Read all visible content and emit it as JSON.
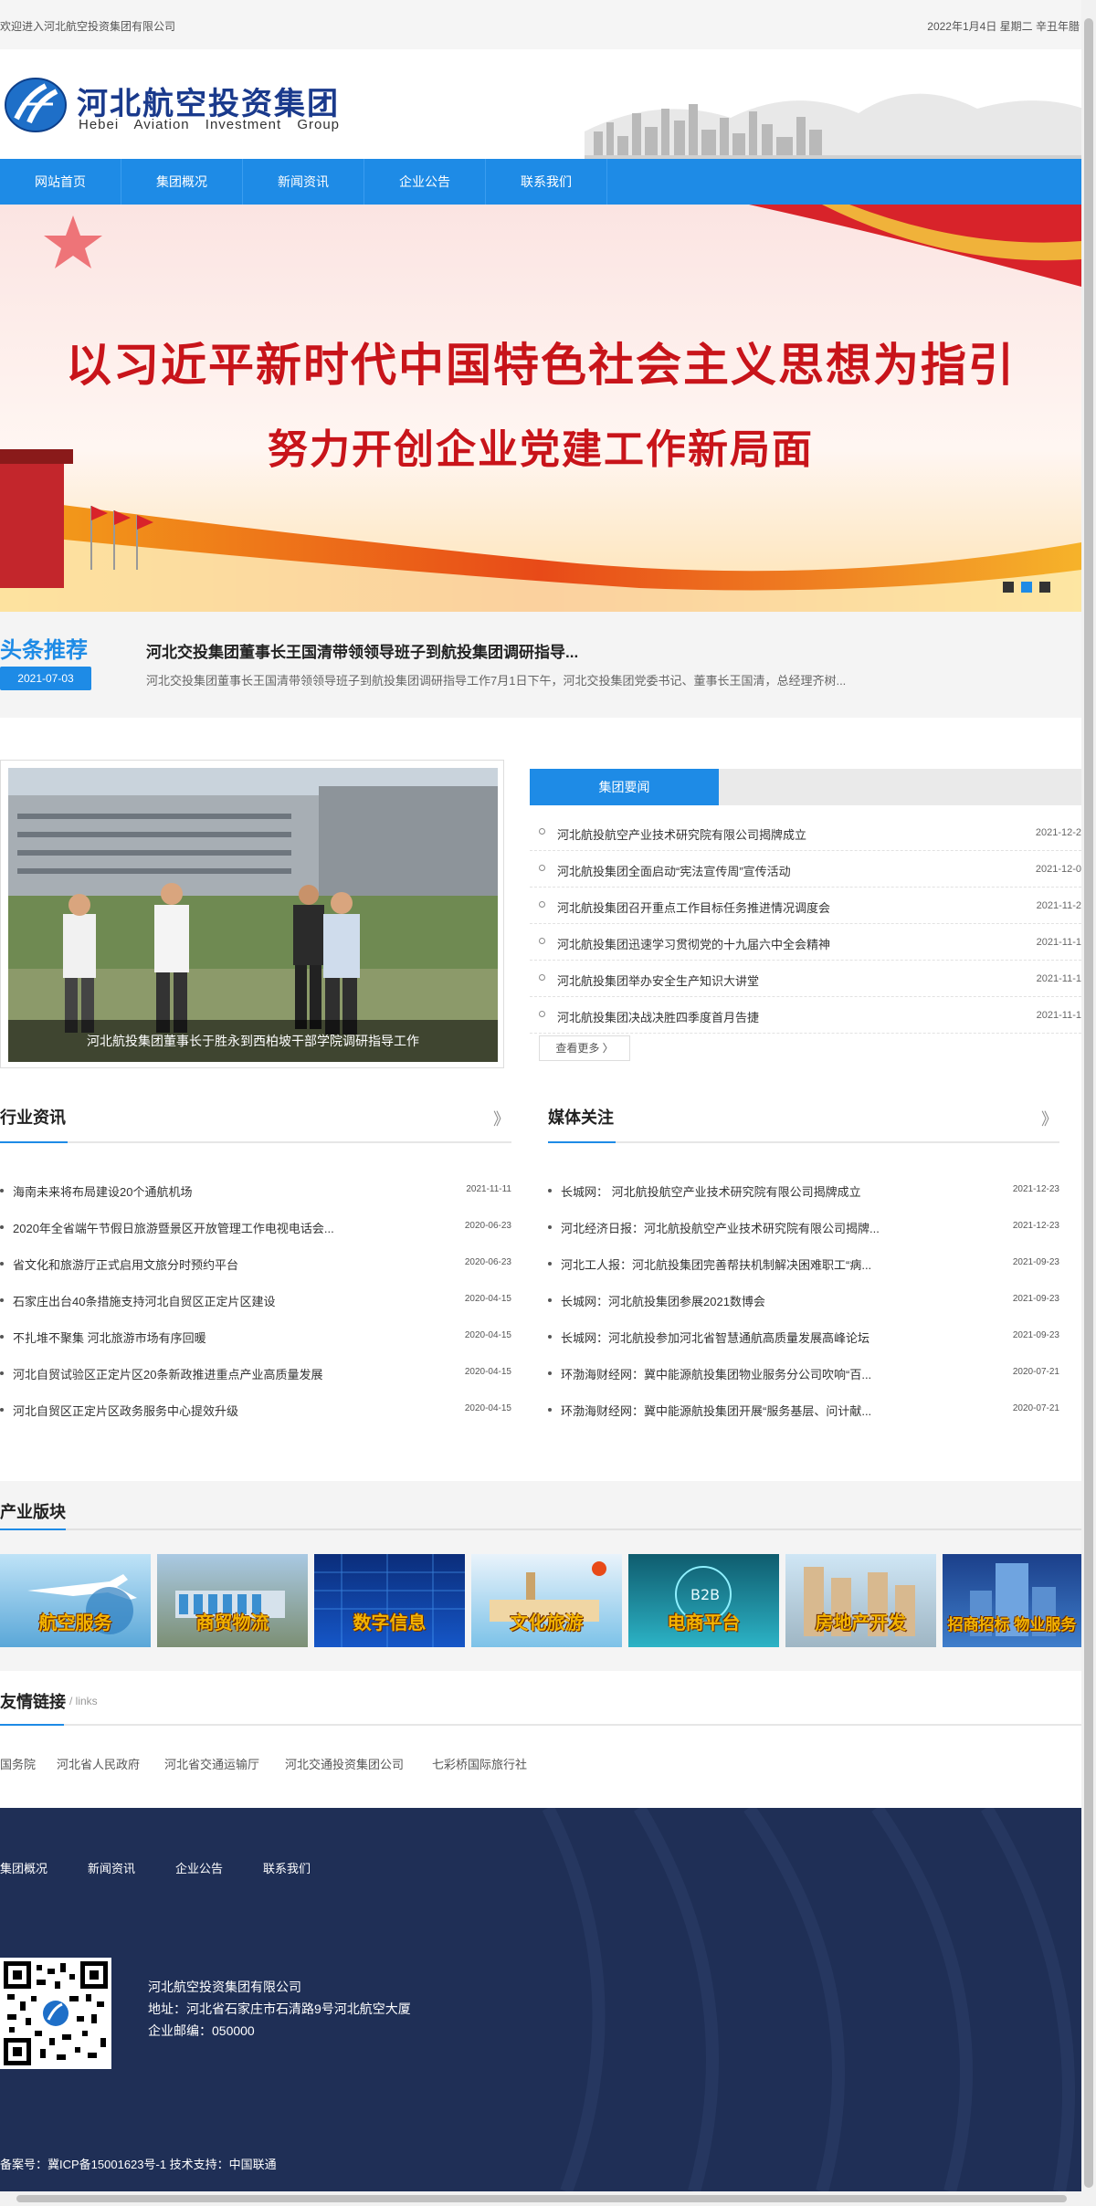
{
  "topbar": {
    "welcome": "欢迎进入河北航空投资集团有限公司",
    "date": "2022年1月4日  星期二  辛丑年腊"
  },
  "logo": {
    "cn": "河北航空投资集团",
    "en": "Hebei Aviation Investment Group"
  },
  "nav": [
    "网站首页",
    "集团概况",
    "新闻资讯",
    "企业公告",
    "联系我们"
  ],
  "banner": {
    "line1": "以习近平新时代中国特色社会主义思想为指引",
    "line2": "努力开创企业党建工作新局面"
  },
  "headline": {
    "label": "头条推荐",
    "date": "2021-07-03",
    "title": "河北交投集团董事长王国清带领领导班子到航投集团调研指导...",
    "desc": "河北交投集团董事长王国清带领领导班子到航投集团调研指导工作7月1日下午，河北交投集团党委书记、董事长王国清，总经理齐树..."
  },
  "photo_news": {
    "caption": "河北航投集团董事长于胜永到西柏坡干部学院调研指导工作"
  },
  "group_news": {
    "tab": "集团要闻",
    "more": "查看更多 〉",
    "items": [
      {
        "title": "河北航投航空产业技术研究院有限公司揭牌成立",
        "date": "2021-12-2"
      },
      {
        "title": "河北航投集团全面启动“宪法宣传周”宣传活动",
        "date": "2021-12-0"
      },
      {
        "title": "河北航投集团召开重点工作目标任务推进情况调度会",
        "date": "2021-11-2"
      },
      {
        "title": "河北航投集团迅速学习贯彻党的十九届六中全会精神",
        "date": "2021-11-1"
      },
      {
        "title": "河北航投集团举办安全生产知识大讲堂",
        "date": "2021-11-1"
      },
      {
        "title": "河北航投集团决战决胜四季度首月告捷",
        "date": "2021-11-1"
      }
    ]
  },
  "industry_news": {
    "title": "行业资讯",
    "arrow": "》",
    "items": [
      {
        "title": "海南未来将布局建设20个通航机场",
        "date": "2021-11-11"
      },
      {
        "title": "2020年全省端午节假日旅游暨景区开放管理工作电视电话会...",
        "date": "2020-06-23"
      },
      {
        "title": "省文化和旅游厅正式启用文旅分时预约平台",
        "date": "2020-06-23"
      },
      {
        "title": "石家庄出台40条措施支持河北自贸区正定片区建设",
        "date": "2020-04-15"
      },
      {
        "title": "不扎堆不聚集 河北旅游市场有序回暖",
        "date": "2020-04-15"
      },
      {
        "title": "河北自贸试验区正定片区20条新政推进重点产业高质量发展",
        "date": "2020-04-15"
      },
      {
        "title": "河北自贸区正定片区政务服务中心提效升级",
        "date": "2020-04-15"
      }
    ]
  },
  "media_news": {
    "title": "媒体关注",
    "arrow": "》",
    "items": [
      {
        "title": "长城网： 河北航投航空产业技术研究院有限公司揭牌成立",
        "date": "2021-12-23"
      },
      {
        "title": "河北经济日报：河北航投航空产业技术研究院有限公司揭牌...",
        "date": "2021-12-23"
      },
      {
        "title": "河北工人报：河北航投集团完善帮扶机制解决困难职工“病...",
        "date": "2021-09-23"
      },
      {
        "title": "长城网：河北航投集团参展2021数博会",
        "date": "2021-09-23"
      },
      {
        "title": "长城网：河北航投参加河北省智慧通航高质量发展高峰论坛",
        "date": "2021-09-23"
      },
      {
        "title": "环渤海财经网：冀中能源航投集团物业服务分公司吹响“百...",
        "date": "2020-07-21"
      },
      {
        "title": "环渤海财经网：冀中能源航投集团开展“服务基层、问计献...",
        "date": "2020-07-21"
      }
    ]
  },
  "industry": {
    "title": "产业版块",
    "tiles": [
      "航空服务",
      "商贸物流",
      "数字信息",
      "文化旅游",
      "电商平台",
      "房地产开发",
      "招商招标 物业服务"
    ]
  },
  "links": {
    "title": "友情链接",
    "sub": "/ links",
    "items": [
      "国务院",
      "河北省人民政府",
      "河北省交通运输厅",
      "河北交通投资集团公司",
      "七彩桥国际旅行社"
    ]
  },
  "footer": {
    "nav": [
      "集团概况",
      "新闻资讯",
      "企业公告",
      "联系我们"
    ],
    "company": "河北航空投资集团有限公司",
    "address": "地址：河北省石家庄市石清路9号河北航空大厦",
    "postcode": "企业邮编：050000",
    "copyright": "备案号：冀ICP备15001623号-1   技术支持：中国联通"
  },
  "colors": {
    "primary": "#1e8be6",
    "footer_bg": "#1f2f56",
    "banner_text": "#c8141a"
  }
}
